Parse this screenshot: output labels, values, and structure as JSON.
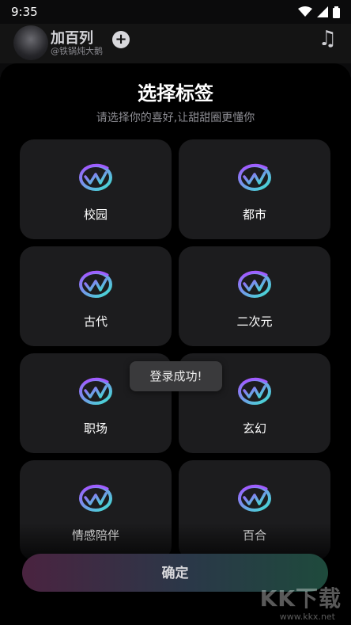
{
  "status_bar": {
    "time": "9:35"
  },
  "top_bar": {
    "name": "加百列",
    "handle": "@铁锅炖大鹅",
    "plus": "+",
    "music_icon": "music-note-icon"
  },
  "sheet": {
    "title": "选择标签",
    "subtitle": "请选择你的喜好,让甜甜圈更懂你",
    "tags": [
      {
        "label": "校园"
      },
      {
        "label": "都市"
      },
      {
        "label": "古代"
      },
      {
        "label": "二次元"
      },
      {
        "label": "职场"
      },
      {
        "label": "玄幻"
      },
      {
        "label": "情感陪伴"
      },
      {
        "label": "百合"
      }
    ],
    "confirm_label": "确定"
  },
  "toast": {
    "text": "登录成功!"
  },
  "watermark": {
    "main": "KK下载",
    "url": "www.kkx.net"
  },
  "colors": {
    "icon_gradient_start": "#a05cff",
    "icon_gradient_end": "#3fe0d0",
    "card_bg": "#1c1c1e"
  }
}
